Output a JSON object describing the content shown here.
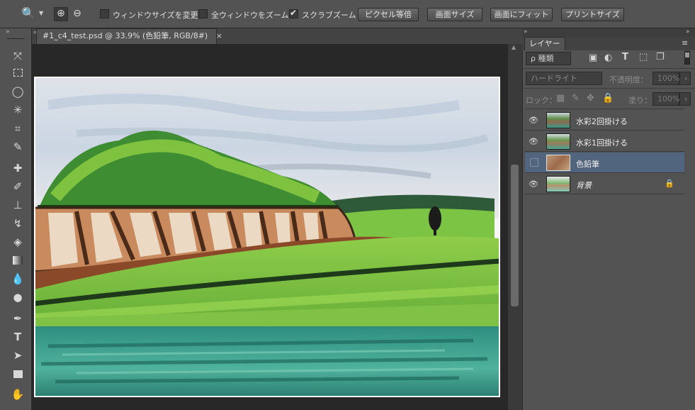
{
  "options_bar": {
    "zoom_in_label": "⊕",
    "zoom_out_label": "⊖",
    "resize_windows": {
      "label": "ウィンドウサイズを変更",
      "checked": false
    },
    "zoom_all_windows": {
      "label": "全ウィンドウをズーム",
      "checked": false
    },
    "scrubby_zoom": {
      "label": "スクラブズーム",
      "checked": true
    },
    "buttons": {
      "actual_pixels": "ピクセル等倍",
      "fit_screen": "画面サイズ",
      "fill_screen": "画面にフィット",
      "print_size": "プリントサイズ"
    }
  },
  "document": {
    "tab_title": "#1_c4_test.psd @ 33.9% (色鉛筆, RGB/8#)",
    "close_glyph": "×"
  },
  "layers_panel": {
    "tab_label": "レイヤー",
    "filter_kind": "ρ 種類",
    "blend_mode": "ハードライト",
    "opacity_label": "不透明度：",
    "opacity_value": "100%",
    "lock_label": "ロック：",
    "fill_label": "塗り：",
    "fill_value": "100%",
    "layers": [
      {
        "name": "水彩2回掛ける",
        "visible": true,
        "selected": false
      },
      {
        "name": "水彩1回掛ける",
        "visible": true,
        "selected": false
      },
      {
        "name": "色鉛筆",
        "visible": false,
        "selected": true
      },
      {
        "name": "背景",
        "visible": true,
        "selected": false,
        "locked": true
      }
    ]
  },
  "icons": {
    "eye": "eye-icon",
    "lock": "lock-icon"
  },
  "colors": {
    "ui_dark": "#282828",
    "panel": "#535353",
    "selection": "#51667e"
  }
}
